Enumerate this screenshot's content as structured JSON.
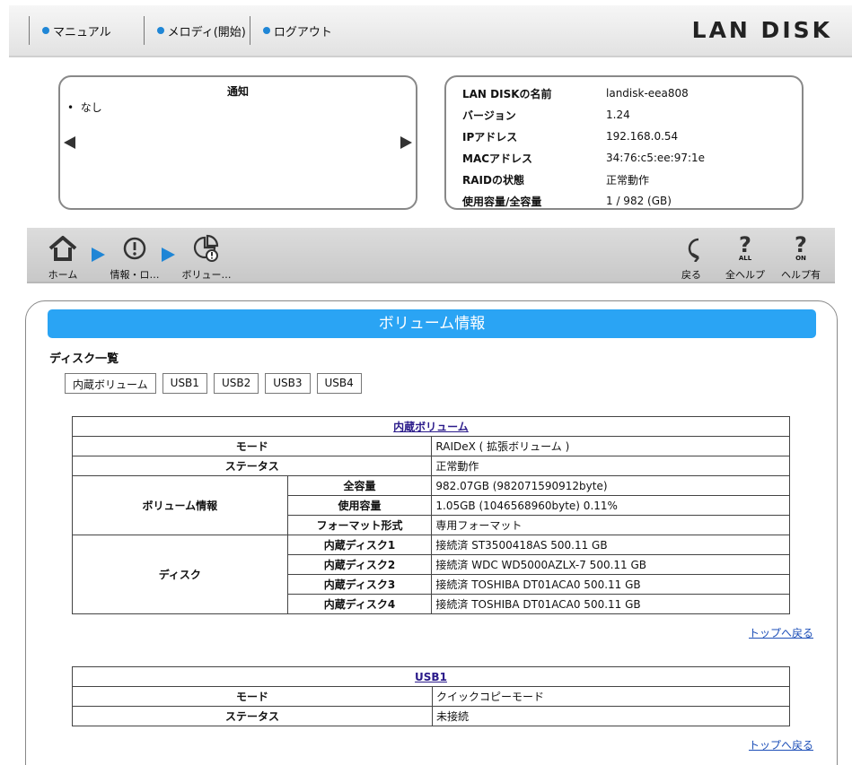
{
  "topbar": {
    "links": [
      "マニュアル",
      "メロディ(開始)",
      "ログアウト"
    ],
    "brand": "LAN DISK"
  },
  "notice": {
    "title": "通知",
    "items": [
      "なし"
    ]
  },
  "sysinfo": {
    "rows": [
      {
        "k": "LAN DISKの名前",
        "v": "landisk-eea808"
      },
      {
        "k": "バージョン",
        "v": "1.24"
      },
      {
        "k": "IPアドレス",
        "v": "192.168.0.54"
      },
      {
        "k": "MACアドレス",
        "v": "34:76:c5:ee:97:1e"
      },
      {
        "k": "RAIDの状態",
        "v": "正常動作"
      },
      {
        "k": "使用容量/全容量",
        "v": "1 / 982 (GB)"
      }
    ]
  },
  "navbar": {
    "home": "ホーム",
    "info": "情報・ロ…",
    "volume": "ボリュー…",
    "back": "戻る",
    "all_help": "全ヘルプ",
    "help_on": "ヘルプ有",
    "all_badge": "ALL",
    "on_badge": "ON"
  },
  "main": {
    "banner": "ボリューム情報",
    "disk_list_title": "ディスク一覧",
    "tabs": [
      "内蔵ボリューム",
      "USB1",
      "USB2",
      "USB3",
      "USB4"
    ],
    "to_top": "トップへ戻る",
    "internal": {
      "title": "内蔵ボリューム",
      "mode_label": "モード",
      "mode": "RAIDeX ( 拡張ボリューム )",
      "status_label": "ステータス",
      "status": "正常動作",
      "volinfo_label": "ボリューム情報",
      "total_label": "全容量",
      "total": "982.07GB (982071590912byte)",
      "used_label": "使用容量",
      "used": "1.05GB (1046568960byte) 0.11%",
      "format_label": "フォーマット形式",
      "format": "専用フォーマット",
      "disk_label": "ディスク",
      "disks": [
        {
          "k": "内蔵ディスク1",
          "v": "接続済 ST3500418AS 500.11 GB"
        },
        {
          "k": "内蔵ディスク2",
          "v": "接続済 WDC WD5000AZLX-7 500.11 GB"
        },
        {
          "k": "内蔵ディスク3",
          "v": "接続済 TOSHIBA DT01ACA0 500.11 GB"
        },
        {
          "k": "内蔵ディスク4",
          "v": "接続済 TOSHIBA DT01ACA0 500.11 GB"
        }
      ]
    },
    "usb1": {
      "title": "USB1",
      "mode_label": "モード",
      "mode": "クイックコピーモード",
      "status_label": "ステータス",
      "status": "未接続"
    }
  }
}
